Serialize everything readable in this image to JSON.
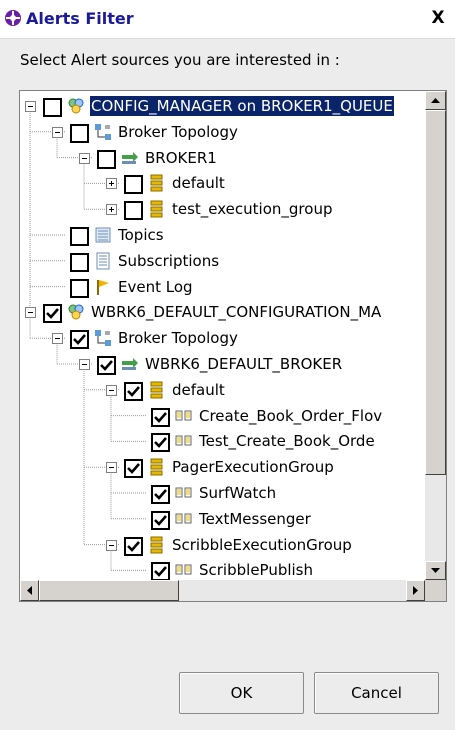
{
  "window": {
    "title": "Alerts Filter",
    "close_glyph": "X"
  },
  "prompt": "Select Alert sources you are interested in :",
  "tree": [
    {
      "depth": 0,
      "expander": "minus",
      "checked": false,
      "icon": "config-manager-icon",
      "label": "CONFIG_MANAGER on BROKER1_QUEUE",
      "selected": true
    },
    {
      "depth": 1,
      "expander": "minus",
      "checked": false,
      "icon": "broker-topology-icon",
      "label": "Broker Topology"
    },
    {
      "depth": 2,
      "expander": "minus",
      "checked": false,
      "icon": "broker-icon",
      "label": "BROKER1"
    },
    {
      "depth": 3,
      "expander": "plus",
      "checked": false,
      "icon": "execution-group-icon",
      "label": "default"
    },
    {
      "depth": 3,
      "expander": "plus",
      "checked": false,
      "icon": "execution-group-icon",
      "label": "test_execution_group"
    },
    {
      "depth": 1,
      "expander": "none",
      "checked": false,
      "icon": "topics-icon",
      "label": "Topics"
    },
    {
      "depth": 1,
      "expander": "none",
      "checked": false,
      "icon": "subscriptions-icon",
      "label": "Subscriptions"
    },
    {
      "depth": 1,
      "expander": "none",
      "checked": false,
      "icon": "event-log-icon",
      "label": "Event Log"
    },
    {
      "depth": 0,
      "expander": "minus",
      "checked": true,
      "icon": "config-manager-icon",
      "label": "WBRK6_DEFAULT_CONFIGURATION_MA"
    },
    {
      "depth": 1,
      "expander": "minus",
      "checked": true,
      "icon": "broker-topology-icon",
      "label": "Broker Topology"
    },
    {
      "depth": 2,
      "expander": "minus",
      "checked": true,
      "icon": "broker-icon",
      "label": "WBRK6_DEFAULT_BROKER"
    },
    {
      "depth": 3,
      "expander": "minus",
      "checked": true,
      "icon": "execution-group-icon",
      "label": "default"
    },
    {
      "depth": 4,
      "expander": "none",
      "checked": true,
      "icon": "message-flow-icon",
      "label": "Create_Book_Order_Flov"
    },
    {
      "depth": 4,
      "expander": "none",
      "checked": true,
      "icon": "message-flow-icon",
      "label": "Test_Create_Book_Orde"
    },
    {
      "depth": 3,
      "expander": "minus",
      "checked": true,
      "icon": "execution-group-icon",
      "label": "PagerExecutionGroup"
    },
    {
      "depth": 4,
      "expander": "none",
      "checked": true,
      "icon": "message-flow-icon",
      "label": "SurfWatch"
    },
    {
      "depth": 4,
      "expander": "none",
      "checked": true,
      "icon": "message-flow-icon",
      "label": "TextMessenger"
    },
    {
      "depth": 3,
      "expander": "minus",
      "checked": true,
      "icon": "execution-group-icon",
      "label": "ScribbleExecutionGroup"
    },
    {
      "depth": 4,
      "expander": "none",
      "checked": true,
      "icon": "message-flow-icon",
      "label": "ScribblePublish"
    }
  ],
  "buttons": {
    "ok": "OK",
    "cancel": "Cancel"
  },
  "colors": {
    "selection": "#0a246a",
    "title_text": "#1a1a9a"
  }
}
